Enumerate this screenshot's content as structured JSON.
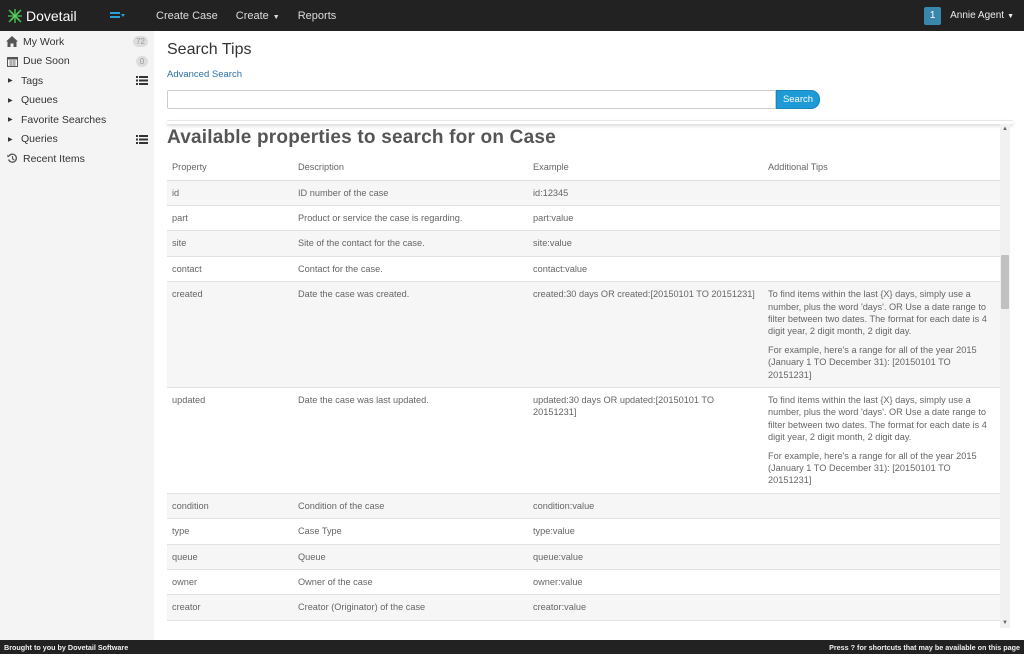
{
  "app": {
    "brand": "Dovetail"
  },
  "topnav": {
    "links": [
      {
        "label": "Create Case"
      },
      {
        "label": "Create"
      },
      {
        "label": "Reports"
      }
    ],
    "notifications_count": "1",
    "user": "Annie Agent"
  },
  "sidebar": {
    "items": [
      {
        "label": "My Work",
        "icon": "home-icon",
        "count": "72"
      },
      {
        "label": "Due Soon",
        "icon": "calendar-icon",
        "count": "0"
      },
      {
        "label": "Tags",
        "icon": "caret-right-icon"
      },
      {
        "label": "Queues",
        "icon": "caret-right-icon"
      },
      {
        "label": "Favorite Searches",
        "icon": "caret-right-icon"
      },
      {
        "label": "Queries",
        "icon": "caret-right-icon"
      },
      {
        "label": "Recent Items",
        "icon": "history-icon"
      }
    ]
  },
  "page": {
    "title": "Search Tips",
    "advanced_link": "Advanced Search",
    "search_value": "",
    "search_button": "Search"
  },
  "properties": {
    "title": "Available properties to search for on Case",
    "headers": [
      "Property",
      "Description",
      "Example",
      "Additional Tips"
    ],
    "rows": [
      {
        "property": "id",
        "description": "ID number of the case",
        "example": "id:12345",
        "tips": []
      },
      {
        "property": "part",
        "description": "Product or service the case is regarding.",
        "example": "part:value",
        "tips": []
      },
      {
        "property": "site",
        "description": "Site of the contact for the case.",
        "example": "site:value",
        "tips": []
      },
      {
        "property": "contact",
        "description": "Contact for the case.",
        "example": "contact:value",
        "tips": []
      },
      {
        "property": "created",
        "description": "Date the case was created.",
        "example": "created:30 days OR created:[20150101 TO 20151231]",
        "tips": [
          "To find items within the last {X} days, simply use a number, plus the word 'days'. OR Use a date range to filter between two dates. The format for each date is 4 digit year, 2 digit month, 2 digit day.",
          "For example, here's a range for all of the year 2015 (January 1 TO December 31): [20150101 TO 20151231]"
        ]
      },
      {
        "property": "updated",
        "description": "Date the case was last updated.",
        "example": "updated:30 days OR updated:[20150101 TO 20151231]",
        "tips": [
          "To find items within the last {X} days, simply use a number, plus the word 'days'. OR Use a date range to filter between two dates. The format for each date is 4 digit year, 2 digit month, 2 digit day.",
          "For example, here's a range for all of the year 2015 (January 1 TO December 31): [20150101 TO 20151231]"
        ]
      },
      {
        "property": "condition",
        "description": "Condition of the case",
        "example": "condition:value",
        "tips": []
      },
      {
        "property": "type",
        "description": "Case Type",
        "example": "type:value",
        "tips": []
      },
      {
        "property": "queue",
        "description": "Queue",
        "example": "queue:value",
        "tips": []
      },
      {
        "property": "owner",
        "description": "Owner of the case",
        "example": "owner:value",
        "tips": []
      },
      {
        "property": "creator",
        "description": "Creator (Originator) of the case",
        "example": "creator:value",
        "tips": []
      }
    ]
  },
  "footer": {
    "left": "Brought to you by Dovetail Software",
    "right": "Press ? for shortcuts that may be available on this page"
  },
  "colors": {
    "nav_bg": "#222222",
    "accent": "#1e9ad6",
    "link": "#2a6fa8",
    "badge": "#3a87ad",
    "brand_green": "#3bb54a"
  }
}
